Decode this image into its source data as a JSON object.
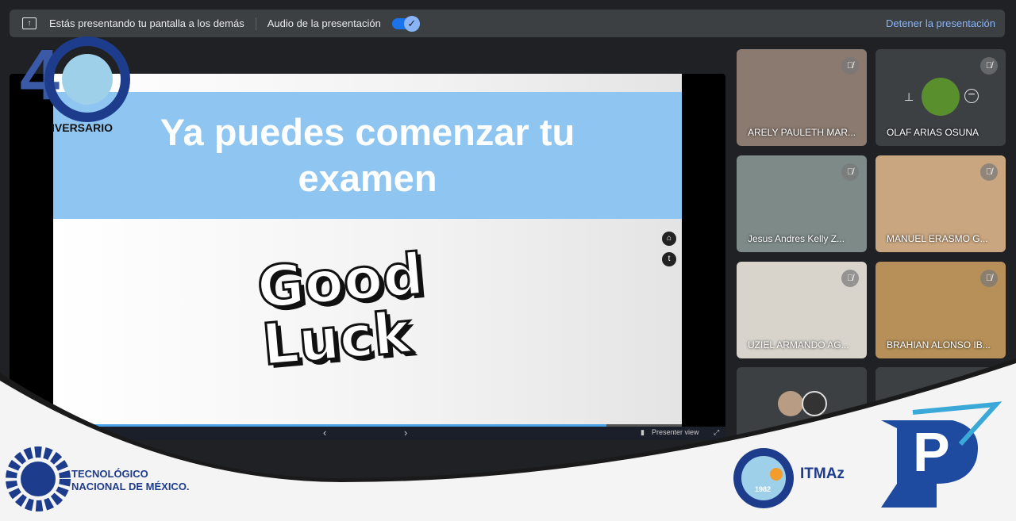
{
  "topbar": {
    "presenting_msg": "Estás presentando tu pantalla a los demás",
    "audio_label": "Audio de la presentación",
    "audio_enabled": true,
    "stop_label": "Detener la presentación"
  },
  "slide": {
    "title": "Ya puedes comenzar tu examen",
    "art_text_1": "Good",
    "art_text_2": "Luck",
    "progress_percent": 88
  },
  "slide_controls": {
    "prev": "‹",
    "next": "›",
    "presenter_view": "Presenter view"
  },
  "participants": [
    {
      "name": "ARELY PAULETH MAR...",
      "muted": true,
      "bg": "#8a7a70"
    },
    {
      "name": "OLAF ARIAS OSUNA",
      "muted": true,
      "bg": "#3c4043"
    },
    {
      "name": "Jesus Andres Kelly Z...",
      "muted": true,
      "bg": "#7d8a88"
    },
    {
      "name": "MANUEL ERASMO G...",
      "muted": true,
      "bg": "#c9a680"
    },
    {
      "name": "UZIEL ARMANDO AG...",
      "muted": true,
      "bg": "#d8d4cc"
    },
    {
      "name": "BRAHIAN ALONSO IB...",
      "muted": true,
      "bg": "#b69058"
    }
  ],
  "logos": {
    "anniversary": "40 ANIVERSARIO 1982-2022",
    "tecnm_line1": "TECNOLÓGICO",
    "tecnm_line2": "NACIONAL DE MÉXICO.",
    "itmaz": "ITMAz",
    "itmaz_year": "1982",
    "pez": "P"
  },
  "colors": {
    "accent": "#8ab4f8",
    "band": "#8ec5f1",
    "logo_blue": "#1e3c8c"
  }
}
